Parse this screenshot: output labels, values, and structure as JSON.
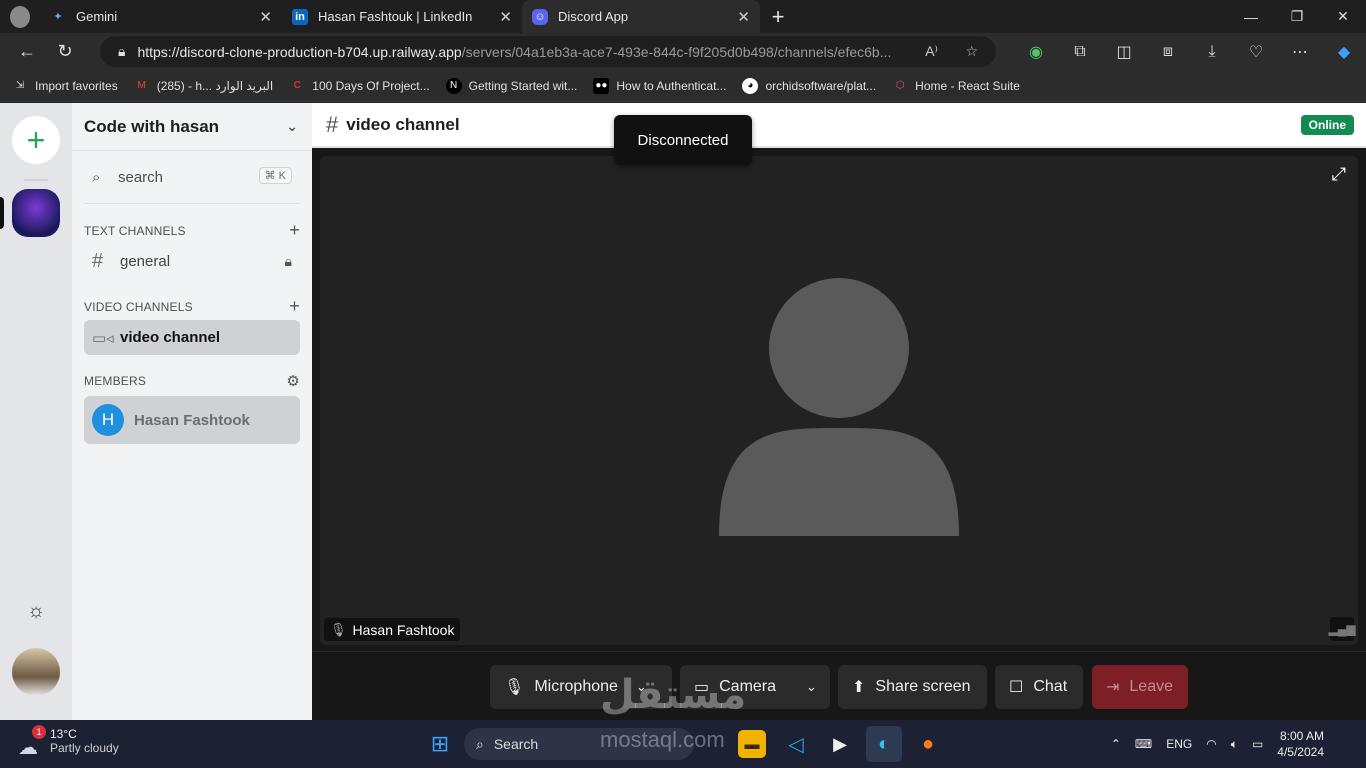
{
  "browser": {
    "tabs": [
      {
        "title": "Gemini",
        "icon": "gemini-icon"
      },
      {
        "title": "Hasan Fashtouk | LinkedIn",
        "icon": "linkedin-icon"
      },
      {
        "title": "Discord App",
        "icon": "discord-icon",
        "active": true
      }
    ],
    "url_host": "https://discord-clone-production-b704.up.railway.app",
    "url_path": "/servers/04a1eb3a-ace7-493e-844c-f9f205d0b498/channels/efec6b...",
    "favorites": [
      {
        "label": "Import favorites",
        "icon": "import-icon"
      },
      {
        "label": "(285) - h... البريد الوارد",
        "icon": "gmail-icon"
      },
      {
        "label": "100 Days Of Project...",
        "icon": "red-c-icon"
      },
      {
        "label": "Getting Started wit...",
        "icon": "nextjs-icon"
      },
      {
        "label": "How to Authenticat...",
        "icon": "medium-icon"
      },
      {
        "label": "orchidsoftware/plat...",
        "icon": "github-icon"
      },
      {
        "label": "Home - React Suite",
        "icon": "rsuite-icon"
      }
    ]
  },
  "sidebar": {
    "server_name": "Code with hasan",
    "search_placeholder": "search",
    "search_shortcut": "⌘ K",
    "text_channels_label": "TEXT CHANNELS",
    "text_channels": [
      "general"
    ],
    "video_channels_label": "VIDEO CHANNELS",
    "video_channels": [
      "video channel"
    ],
    "members_label": "MEMBERS",
    "members": [
      {
        "name": "Hasan Fashtook",
        "initial": "H"
      }
    ]
  },
  "main": {
    "channel_title": "video channel",
    "status_badge": "Online",
    "toast": "Disconnected",
    "participant_name": "Hasan Fashtook",
    "controls": {
      "microphone": "Microphone",
      "camera": "Camera",
      "share_screen": "Share screen",
      "chat": "Chat",
      "leave": "Leave"
    }
  },
  "taskbar": {
    "weather_temp": "13°C",
    "weather_desc": "Partly cloudy",
    "weather_badge": "1",
    "search_label": "Search",
    "language": "ENG",
    "time": "8:00 AM",
    "date": "4/5/2024"
  },
  "watermark": {
    "main": "مستقل",
    "sub": "mostaql.com"
  },
  "colors": {
    "online": "#138a4f",
    "leave": "#7e1f26",
    "accent_green": "#23a55a"
  }
}
